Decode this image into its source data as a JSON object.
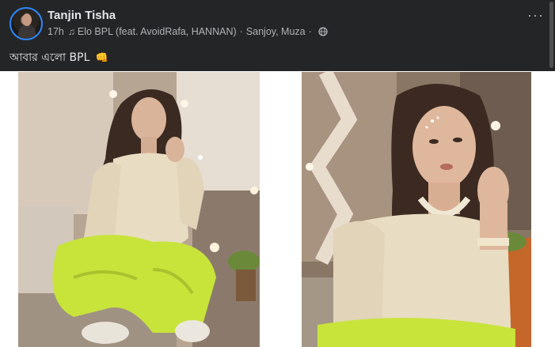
{
  "post": {
    "author": "Tanjin Tisha",
    "time": "17h",
    "music_icon": "music-note-icon",
    "song": "Elo BPL (feat. AvoidRafa, HANNAN)",
    "separator": "·",
    "location": "Sanjoy, Muza",
    "privacy_icon": "globe-icon",
    "more": "···",
    "text": "আবার এলো BPL",
    "emoji": "👊"
  },
  "photos": [
    {
      "name": "photo-left"
    },
    {
      "name": "photo-right"
    }
  ],
  "colors": {
    "header_bg": "#242526",
    "text_primary": "#e4e6eb",
    "text_secondary": "#b0b3b8",
    "avatar_ring": "#2d88ff",
    "outfit_green": "#c8e43a",
    "top_beige": "#e8dcc2"
  }
}
